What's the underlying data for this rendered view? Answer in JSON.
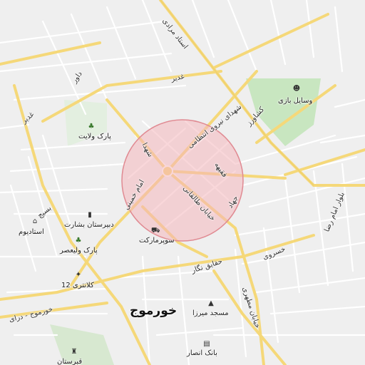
{
  "colors": {
    "background": "#efefef",
    "major_road": "#f5d879",
    "minor_road": "#ffffff",
    "park": "#c8e6c0",
    "highlight_fill": "#f4b7bc",
    "highlight_stroke": "#e08a92"
  },
  "labels": {
    "city": "خورموج",
    "street_ostad_moradi": "استاد مرادی",
    "street_davar": "داور",
    "street_ghadir": "غدیر",
    "street_ghadir_left": "غدیر",
    "street_keshavarz": "کشاورز",
    "street_shohada_niroo": "شهدای نیروی انتظامی",
    "street_shohada": "شهدا",
    "street_imam_khomeini": "امام خمینی",
    "street_faghihe": "فقیهه",
    "street_jahad": "جهاد",
    "street_taleghani": "خیابان طالقانی",
    "street_basij": "بسیج",
    "street_khosravi": "خسروی",
    "street_haghayegh_negar": "حقایق نگار",
    "street_imam_reza": "بلوار امام رضا",
    "street_khormoj_darai": "خورموج - درای",
    "street_motahari": "خیابان مطهری",
    "poi_park_velayat": "پارک ولایت",
    "poi_stadium": "استادیوم",
    "poi_besharat_school": "دبیرستان بشارت",
    "poi_park_valiasr": "پارک ولیعصر",
    "poi_supermarket": "سوپرمارکت",
    "poi_police_12": "کلانتری 12",
    "poi_mirza_mosque": "مسجد میرزا",
    "poi_bank_ansar": "بانک انصار",
    "poi_playground": "وسایل بازی",
    "poi_cemetery": "قبرستان"
  },
  "icons": {
    "park": "tree-icon",
    "stadium": "stadium-icon",
    "school": "school-icon",
    "supermarket": "cart-icon",
    "police": "police-icon",
    "mosque": "mosque-icon",
    "bank": "bank-icon",
    "playground": "playground-icon",
    "cemetery": "cemetery-icon"
  }
}
